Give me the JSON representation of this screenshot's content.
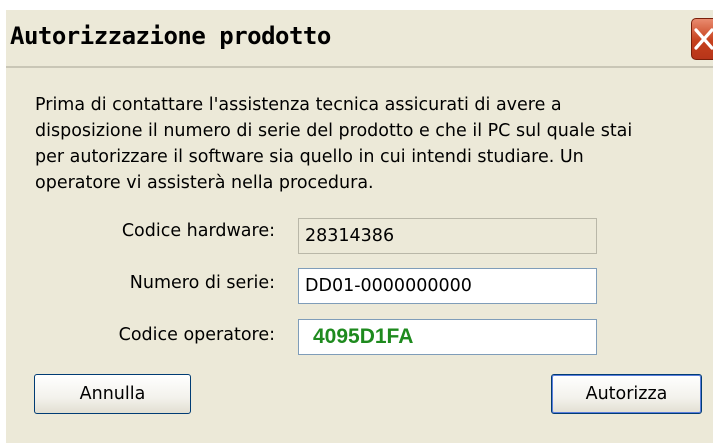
{
  "window": {
    "title": "Autorizzazione prodotto",
    "close_icon": "close-icon"
  },
  "message": {
    "lines": [
      "Prima di contattare l'assistenza tecnica assicurati di avere a",
      "disposizione il numero di serie del prodotto e che il PC sul quale stai",
      "per autorizzare il software sia quello in cui intendi studiare. Un",
      "operatore vi assisterà nella procedura."
    ]
  },
  "fields": {
    "hardware_code": {
      "label": "Codice hardware:",
      "value": "28314386"
    },
    "serial_number": {
      "label": "Numero di serie:",
      "value": "DD01-0000000000"
    },
    "operator_code": {
      "label": "Codice operatore:",
      "value": "4095D1FA",
      "color": "#1e8a1e"
    }
  },
  "buttons": {
    "cancel": "Annulla",
    "authorize": "Autorizza"
  },
  "colors": {
    "dialog_background": "#ece9d8",
    "close_button": "#c6401c"
  }
}
